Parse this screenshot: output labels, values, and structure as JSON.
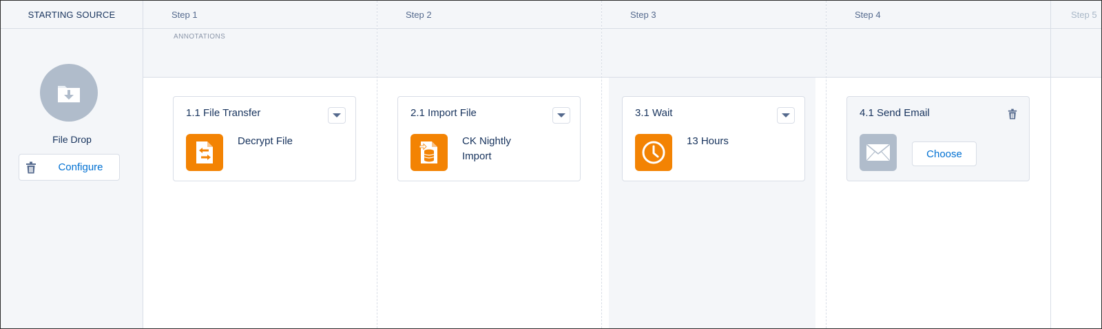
{
  "source": {
    "header": "STARTING SOURCE",
    "label": "File Drop",
    "configure_label": "Configure",
    "icon": "folder-download-icon"
  },
  "annotations_label": "ANNOTATIONS",
  "steps": [
    {
      "header": "Step 1",
      "card": {
        "title": "1.1 File Transfer",
        "detail": "Decrypt File",
        "icon": "file-transfer-icon",
        "color": "#f38303"
      }
    },
    {
      "header": "Step 2",
      "card": {
        "title": "2.1 Import File",
        "detail_line1": "CK Nightly",
        "detail_line2": "Import",
        "icon": "import-database-icon",
        "color": "#f38303"
      }
    },
    {
      "header": "Step 3",
      "card": {
        "title": "3.1 Wait",
        "detail": "13 Hours",
        "icon": "clock-icon",
        "color": "#f38303"
      }
    },
    {
      "header": "Step 4",
      "card": {
        "title": "4.1 Send Email",
        "button": "Choose",
        "icon": "email-icon",
        "color": "#b0bccb"
      }
    },
    {
      "header": "Step 5"
    }
  ],
  "colors": {
    "accent": "#0070d2",
    "activity": "#f38303",
    "text": "#16325c",
    "muted": "#b0bccb"
  }
}
